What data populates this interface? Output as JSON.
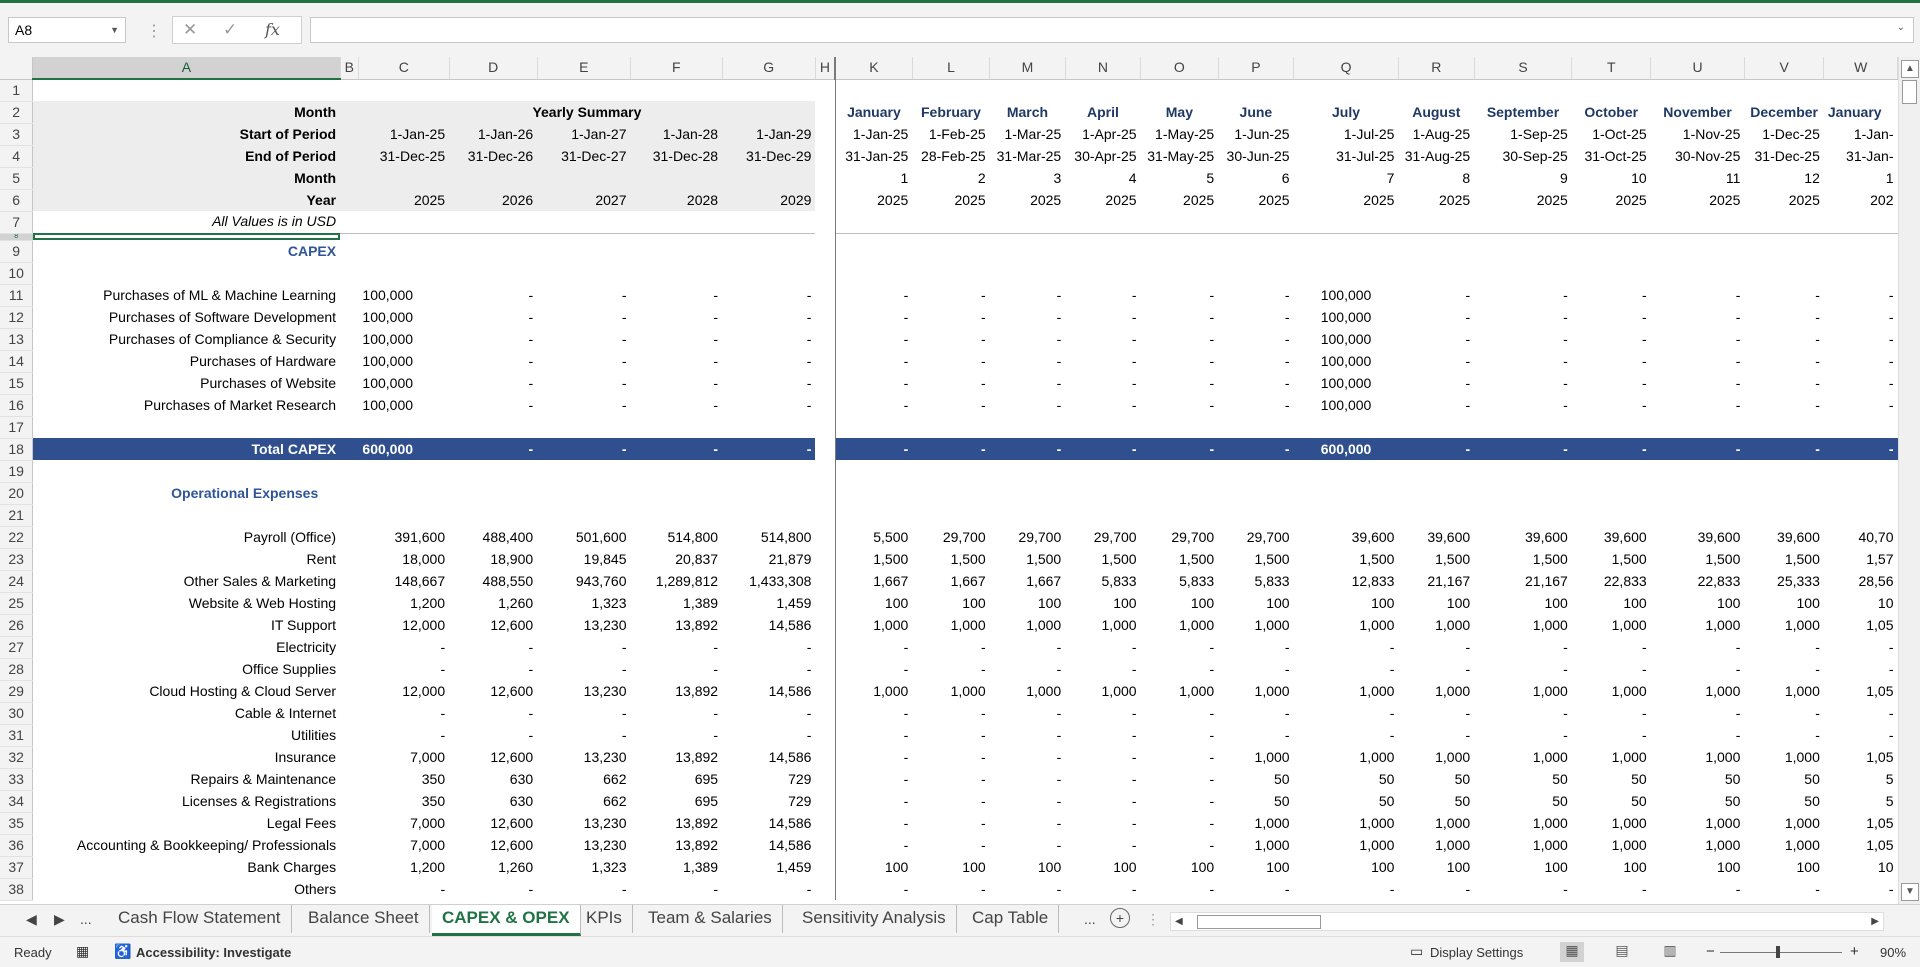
{
  "formula_bar": {
    "name_box": "A8",
    "cancel_icon": "✕",
    "enter_icon": "✓",
    "fx": "fx",
    "formula": ""
  },
  "columns": [
    "A",
    "B",
    "C",
    "D",
    "E",
    "F",
    "G",
    "H",
    "K",
    "L",
    "M",
    "N",
    "O",
    "P",
    "Q",
    "R",
    "S",
    "T",
    "U",
    "V",
    "W"
  ],
  "selected_column": "A",
  "selected_row": "8",
  "rows": {
    "r2": {
      "label": "Month",
      "yearly": "Yearly Summary",
      "m": [
        "January",
        "February",
        "March",
        "April",
        "May",
        "June",
        "July",
        "August",
        "September",
        "October",
        "November",
        "December",
        "January"
      ]
    },
    "r3": {
      "label": "Start of Period",
      "y": [
        "1-Jan-25",
        "1-Jan-26",
        "1-Jan-27",
        "1-Jan-28",
        "1-Jan-29"
      ],
      "m": [
        "1-Jan-25",
        "1-Feb-25",
        "1-Mar-25",
        "1-Apr-25",
        "1-May-25",
        "1-Jun-25",
        "1-Jul-25",
        "1-Aug-25",
        "1-Sep-25",
        "1-Oct-25",
        "1-Nov-25",
        "1-Dec-25",
        "1-Jan-"
      ]
    },
    "r4": {
      "label": "End of Period",
      "y": [
        "31-Dec-25",
        "31-Dec-26",
        "31-Dec-27",
        "31-Dec-28",
        "31-Dec-29"
      ],
      "m": [
        "31-Jan-25",
        "28-Feb-25",
        "31-Mar-25",
        "30-Apr-25",
        "31-May-25",
        "30-Jun-25",
        "31-Jul-25",
        "31-Aug-25",
        "30-Sep-25",
        "31-Oct-25",
        "30-Nov-25",
        "31-Dec-25",
        "31-Jan-"
      ]
    },
    "r5": {
      "label": "Month",
      "y": [
        "",
        "",
        "",
        "",
        ""
      ],
      "m": [
        "1",
        "2",
        "3",
        "4",
        "5",
        "6",
        "7",
        "8",
        "9",
        "10",
        "11",
        "12",
        "1"
      ]
    },
    "r6": {
      "label": "Year",
      "y": [
        "2025",
        "2026",
        "2027",
        "2028",
        "2029"
      ],
      "m": [
        "2025",
        "2025",
        "2025",
        "2025",
        "2025",
        "2025",
        "2025",
        "2025",
        "2025",
        "2025",
        "2025",
        "2025",
        "202"
      ]
    },
    "r7": {
      "label": "All Values is in USD"
    },
    "r9": {
      "label": "CAPEX"
    },
    "r11": {
      "label": "Purchases of ML & Machine Learning",
      "y": [
        "100,000",
        "-",
        "-",
        "-",
        "-"
      ],
      "m": [
        "-",
        "-",
        "-",
        "-",
        "-",
        "-",
        "100,000",
        "-",
        "-",
        "-",
        "-",
        "-",
        "-"
      ]
    },
    "r12": {
      "label": "Purchases of Software Development",
      "y": [
        "100,000",
        "-",
        "-",
        "-",
        "-"
      ],
      "m": [
        "-",
        "-",
        "-",
        "-",
        "-",
        "-",
        "100,000",
        "-",
        "-",
        "-",
        "-",
        "-",
        "-"
      ]
    },
    "r13": {
      "label": "Purchases of Compliance & Security",
      "y": [
        "100,000",
        "-",
        "-",
        "-",
        "-"
      ],
      "m": [
        "-",
        "-",
        "-",
        "-",
        "-",
        "-",
        "100,000",
        "-",
        "-",
        "-",
        "-",
        "-",
        "-"
      ]
    },
    "r14": {
      "label": "Purchases of Hardware",
      "y": [
        "100,000",
        "-",
        "-",
        "-",
        "-"
      ],
      "m": [
        "-",
        "-",
        "-",
        "-",
        "-",
        "-",
        "100,000",
        "-",
        "-",
        "-",
        "-",
        "-",
        "-"
      ]
    },
    "r15": {
      "label": "Purchases of Website",
      "y": [
        "100,000",
        "-",
        "-",
        "-",
        "-"
      ],
      "m": [
        "-",
        "-",
        "-",
        "-",
        "-",
        "-",
        "100,000",
        "-",
        "-",
        "-",
        "-",
        "-",
        "-"
      ]
    },
    "r16": {
      "label": "Purchases of Market Research",
      "y": [
        "100,000",
        "-",
        "-",
        "-",
        "-"
      ],
      "m": [
        "-",
        "-",
        "-",
        "-",
        "-",
        "-",
        "100,000",
        "-",
        "-",
        "-",
        "-",
        "-",
        "-"
      ]
    },
    "r18": {
      "label": "Total CAPEX",
      "y": [
        "600,000",
        "-",
        "-",
        "-",
        "-"
      ],
      "m": [
        "-",
        "-",
        "-",
        "-",
        "-",
        "-",
        "600,000",
        "-",
        "-",
        "-",
        "-",
        "-",
        "-"
      ]
    },
    "r20": {
      "label": "Operational Expenses"
    },
    "r22": {
      "label": "Payroll (Office)",
      "y": [
        "391,600",
        "488,400",
        "501,600",
        "514,800",
        "514,800"
      ],
      "m": [
        "5,500",
        "29,700",
        "29,700",
        "29,700",
        "29,700",
        "29,700",
        "39,600",
        "39,600",
        "39,600",
        "39,600",
        "39,600",
        "39,600",
        "40,70"
      ]
    },
    "r23": {
      "label": "Rent",
      "y": [
        "18,000",
        "18,900",
        "19,845",
        "20,837",
        "21,879"
      ],
      "m": [
        "1,500",
        "1,500",
        "1,500",
        "1,500",
        "1,500",
        "1,500",
        "1,500",
        "1,500",
        "1,500",
        "1,500",
        "1,500",
        "1,500",
        "1,57"
      ]
    },
    "r24": {
      "label": "Other Sales & Marketing",
      "y": [
        "148,667",
        "488,550",
        "943,760",
        "1,289,812",
        "1,433,308"
      ],
      "m": [
        "1,667",
        "1,667",
        "1,667",
        "5,833",
        "5,833",
        "5,833",
        "12,833",
        "21,167",
        "21,167",
        "22,833",
        "22,833",
        "25,333",
        "28,56"
      ]
    },
    "r25": {
      "label": "Website & Web Hosting",
      "y": [
        "1,200",
        "1,260",
        "1,323",
        "1,389",
        "1,459"
      ],
      "m": [
        "100",
        "100",
        "100",
        "100",
        "100",
        "100",
        "100",
        "100",
        "100",
        "100",
        "100",
        "100",
        "10"
      ]
    },
    "r26": {
      "label": "IT Support",
      "y": [
        "12,000",
        "12,600",
        "13,230",
        "13,892",
        "14,586"
      ],
      "m": [
        "1,000",
        "1,000",
        "1,000",
        "1,000",
        "1,000",
        "1,000",
        "1,000",
        "1,000",
        "1,000",
        "1,000",
        "1,000",
        "1,000",
        "1,05"
      ]
    },
    "r27": {
      "label": "Electricity",
      "y": [
        "-",
        "-",
        "-",
        "-",
        "-"
      ],
      "m": [
        "-",
        "-",
        "-",
        "-",
        "-",
        "-",
        "-",
        "-",
        "-",
        "-",
        "-",
        "-",
        "-"
      ]
    },
    "r28": {
      "label": "Office Supplies",
      "y": [
        "-",
        "-",
        "-",
        "-",
        "-"
      ],
      "m": [
        "-",
        "-",
        "-",
        "-",
        "-",
        "-",
        "-",
        "-",
        "-",
        "-",
        "-",
        "-",
        "-"
      ]
    },
    "r29": {
      "label": "Cloud Hosting & Cloud Server",
      "y": [
        "12,000",
        "12,600",
        "13,230",
        "13,892",
        "14,586"
      ],
      "m": [
        "1,000",
        "1,000",
        "1,000",
        "1,000",
        "1,000",
        "1,000",
        "1,000",
        "1,000",
        "1,000",
        "1,000",
        "1,000",
        "1,000",
        "1,05"
      ]
    },
    "r30": {
      "label": "Cable & Internet",
      "y": [
        "-",
        "-",
        "-",
        "-",
        "-"
      ],
      "m": [
        "-",
        "-",
        "-",
        "-",
        "-",
        "-",
        "-",
        "-",
        "-",
        "-",
        "-",
        "-",
        "-"
      ]
    },
    "r31": {
      "label": "Utilities",
      "y": [
        "-",
        "-",
        "-",
        "-",
        "-"
      ],
      "m": [
        "-",
        "-",
        "-",
        "-",
        "-",
        "-",
        "-",
        "-",
        "-",
        "-",
        "-",
        "-",
        "-"
      ]
    },
    "r32": {
      "label": "Insurance",
      "y": [
        "7,000",
        "12,600",
        "13,230",
        "13,892",
        "14,586"
      ],
      "m": [
        "-",
        "-",
        "-",
        "-",
        "-",
        "1,000",
        "1,000",
        "1,000",
        "1,000",
        "1,000",
        "1,000",
        "1,000",
        "1,05"
      ]
    },
    "r33": {
      "label": "Repairs & Maintenance",
      "y": [
        "350",
        "630",
        "662",
        "695",
        "729"
      ],
      "m": [
        "-",
        "-",
        "-",
        "-",
        "-",
        "50",
        "50",
        "50",
        "50",
        "50",
        "50",
        "50",
        "5"
      ]
    },
    "r34": {
      "label": "Licenses & Registrations",
      "y": [
        "350",
        "630",
        "662",
        "695",
        "729"
      ],
      "m": [
        "-",
        "-",
        "-",
        "-",
        "-",
        "50",
        "50",
        "50",
        "50",
        "50",
        "50",
        "50",
        "5"
      ]
    },
    "r35": {
      "label": "Legal Fees",
      "y": [
        "7,000",
        "12,600",
        "13,230",
        "13,892",
        "14,586"
      ],
      "m": [
        "-",
        "-",
        "-",
        "-",
        "-",
        "1,000",
        "1,000",
        "1,000",
        "1,000",
        "1,000",
        "1,000",
        "1,000",
        "1,05"
      ]
    },
    "r36": {
      "label": "Accounting & Bookkeeping/ Professionals",
      "y": [
        "7,000",
        "12,600",
        "13,230",
        "13,892",
        "14,586"
      ],
      "m": [
        "-",
        "-",
        "-",
        "-",
        "-",
        "1,000",
        "1,000",
        "1,000",
        "1,000",
        "1,000",
        "1,000",
        "1,000",
        "1,05"
      ]
    },
    "r37": {
      "label": "Bank Charges",
      "y": [
        "1,200",
        "1,260",
        "1,323",
        "1,389",
        "1,459"
      ],
      "m": [
        "100",
        "100",
        "100",
        "100",
        "100",
        "100",
        "100",
        "100",
        "100",
        "100",
        "100",
        "100",
        "10"
      ]
    },
    "r38": {
      "label": "Others",
      "y": [
        "-",
        "-",
        "-",
        "-",
        "-"
      ],
      "m": [
        "-",
        "-",
        "-",
        "-",
        "-",
        "-",
        "-",
        "-",
        "-",
        "-",
        "-",
        "-",
        "-"
      ]
    }
  },
  "tabs": {
    "more_left": "...",
    "items": [
      "Cash Flow Statement",
      "Balance Sheet",
      "CAPEX & OPEX",
      "KPIs",
      "Team & Salaries",
      "Sensitivity Analysis",
      "Cap Table"
    ],
    "active": "CAPEX & OPEX",
    "more_right": "...",
    "add": "+"
  },
  "status": {
    "ready": "Ready",
    "accessibility": "Accessibility: Investigate",
    "display_settings": "Display Settings",
    "zoom_minus": "−",
    "zoom_plus": "+",
    "zoom": "90%"
  },
  "colors": {
    "accent": "#217346",
    "total_bg": "#2f4f8f",
    "header_text": "#1f3864",
    "section_text": "#2f5597"
  }
}
